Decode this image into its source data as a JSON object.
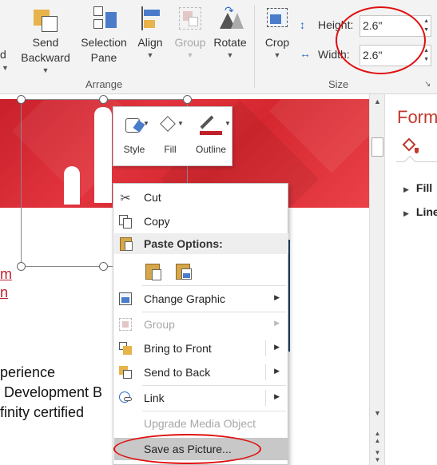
{
  "ribbon": {
    "arrange": {
      "partial_label": "d",
      "send_backward": {
        "line1": "Send",
        "line2": "Backward"
      },
      "selection_pane": {
        "line1": "Selection",
        "line2": "Pane"
      },
      "align": "Align",
      "group": "Group",
      "rotate": "Rotate",
      "group_label": "Arrange"
    },
    "crop": "Crop",
    "size": {
      "height_label": "Height:",
      "height_value": "2.6\"",
      "width_label": "Width:",
      "width_value": "2.6\"",
      "group_label": "Size"
    }
  },
  "slide": {
    "links": [
      "m",
      "n"
    ],
    "lines": [
      "perience",
      " Development B",
      "finity certified"
    ]
  },
  "mini_toolbar": {
    "style": "Style",
    "fill": "Fill",
    "outline": "Outline"
  },
  "context_menu": {
    "cut": "Cut",
    "copy": "Copy",
    "paste_options": "Paste Options:",
    "change_graphic": "Change Graphic",
    "group": "Group",
    "bring_to_front": "Bring to Front",
    "send_to_back": "Send to Back",
    "link": "Link",
    "upgrade_media_object": "Upgrade Media Object",
    "save_as_picture": "Save as Picture..."
  },
  "format_pane": {
    "title": "Form",
    "fill": "Fill",
    "line": "Line"
  },
  "colors": {
    "accent_red": "#c0202a",
    "outline_swatch": "#c0202a",
    "annotation": "#e01010"
  }
}
